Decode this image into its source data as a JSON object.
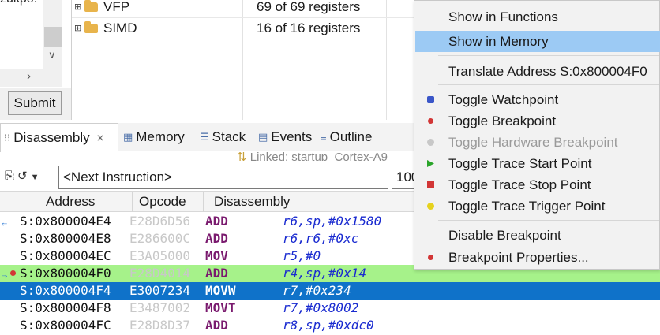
{
  "left_panel": {
    "fragment_text": "zukpo.",
    "submit_label": "Submit"
  },
  "registers": {
    "rows": [
      {
        "name": "VFP",
        "value": "69 of 69 registers"
      },
      {
        "name": "SIMD",
        "value": "16 of 16 registers"
      }
    ]
  },
  "tabs": {
    "disassembly": "Disassembly",
    "memory": "Memory",
    "stack": "Stack",
    "events": "Events",
    "outline": "Outline"
  },
  "linked_text": "Linked: startup_Cortex-A9",
  "toolbar": {
    "nav_value": "<Next Instruction>",
    "addr_value": "100"
  },
  "table": {
    "headers": {
      "address": "Address",
      "opcode": "Opcode",
      "disassembly": "Disassembly"
    },
    "rows": [
      {
        "addr": "S:0x800004E4",
        "op": "E28D6D56",
        "mn": "ADD",
        "args": "r6,sp,#0x1580"
      },
      {
        "addr": "S:0x800004E8",
        "op": "E286600C",
        "mn": "ADD",
        "args": "r6,r6,#0xc"
      },
      {
        "addr": "S:0x800004EC",
        "op": "E3A05000",
        "mn": "MOV",
        "args": "r5,#0"
      },
      {
        "addr": "S:0x800004F0",
        "op": "E28D4014",
        "mn": "ADD",
        "args": "r4,sp,#0x14"
      },
      {
        "addr": "S:0x800004F4",
        "op": "E3007234",
        "mn": "MOVW",
        "args": "r7,#0x234"
      },
      {
        "addr": "S:0x800004F8",
        "op": "E3487002",
        "mn": "MOVT",
        "args": "r7,#0x8002"
      },
      {
        "addr": "S:0x800004FC",
        "op": "E28D8D37",
        "mn": "ADD",
        "args": "r8,sp,#0xdc0"
      }
    ]
  },
  "context_menu": {
    "items": [
      {
        "label": "Show in Functions"
      },
      {
        "label": "Show in Memory"
      },
      {
        "label": "Translate Address S:0x800004F0"
      },
      {
        "label": "Toggle Watchpoint"
      },
      {
        "label": "Toggle Breakpoint"
      },
      {
        "label": "Toggle Hardware Breakpoint"
      },
      {
        "label": "Toggle Trace Start Point"
      },
      {
        "label": "Toggle Trace Stop Point"
      },
      {
        "label": "Toggle Trace Trigger Point"
      },
      {
        "label": "Disable Breakpoint"
      },
      {
        "label": "Breakpoint Properties..."
      }
    ]
  },
  "colors": {
    "selection": "#0f72c9",
    "current_pc_row": "#a6f28a",
    "menu_highlight": "#9ccaf4",
    "mnemonic": "#7a1a6e",
    "register": "#1a2bd0"
  }
}
